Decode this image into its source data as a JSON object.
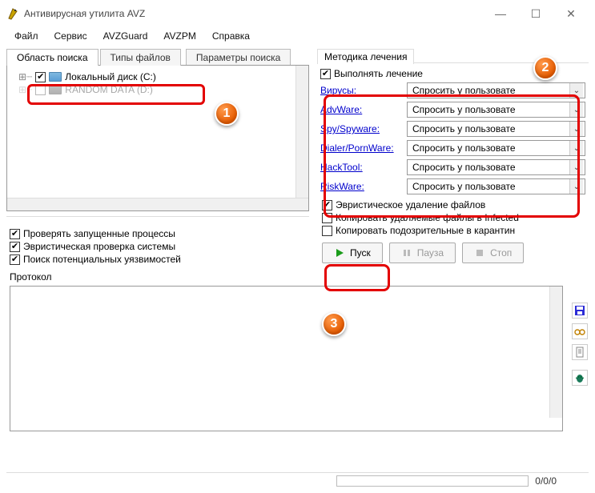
{
  "window": {
    "title": "Антивирусная утилита AVZ"
  },
  "menu": {
    "items": [
      "Файл",
      "Сервис",
      "AVZGuard",
      "AVZPM",
      "Справка"
    ]
  },
  "left": {
    "tabs": [
      "Область поиска",
      "Типы файлов",
      "Параметры поиска"
    ],
    "tree": {
      "disk_c_label": "Локальный диск (C:)",
      "disk_d_label_obscured": "RANDOM DATA (D:)"
    },
    "checks": {
      "running_procs": "Проверять запущенные процессы",
      "heuristic_sys": "Эвристическая проверка системы",
      "vuln_search": "Поиск потенциальных уязвимостей"
    }
  },
  "right": {
    "group_title": "Методика лечения",
    "perform_treatment": "Выполнять лечение",
    "categories": [
      "Вирусы:",
      "AdvWare:",
      "Spy/Spyware:",
      "Dialer/PornWare:",
      "HackTool:",
      "RiskWare:"
    ],
    "dropdown_value": "Спросить у пользовате",
    "checks": {
      "heuristic_del": "Эвристическое удаление файлов",
      "copy_infected": "Копировать удаляемые файлы в  Infected",
      "copy_quarantine": "Копировать подозрительные в  карантин"
    },
    "buttons": {
      "start": "Пуск",
      "pause": "Пауза",
      "stop": "Стоп"
    }
  },
  "protocol": {
    "label": "Протокол"
  },
  "status": {
    "counts": "0/0/0"
  },
  "annotations": {
    "n1": "1",
    "n2": "2",
    "n3": "3"
  }
}
